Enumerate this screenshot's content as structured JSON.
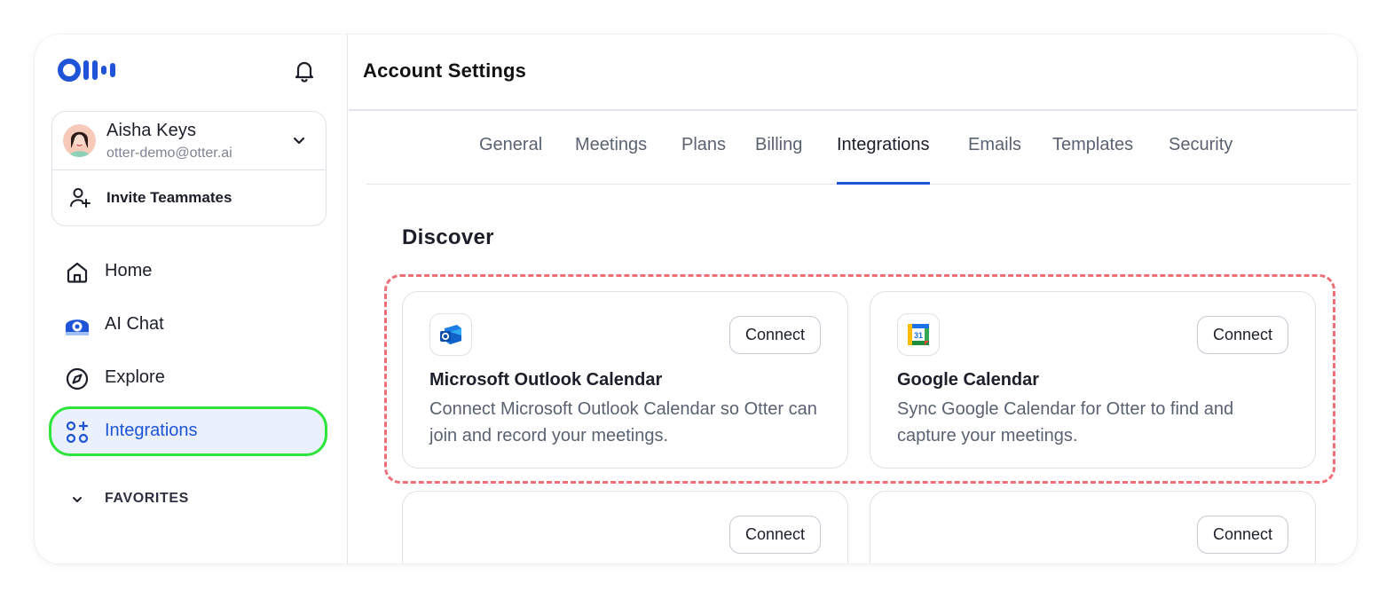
{
  "sidebar": {
    "user": {
      "name": "Aisha Keys",
      "email": "otter-demo@otter.ai"
    },
    "invite_label": "Invite Teammates",
    "nav": [
      {
        "label": "Home",
        "icon": "home-icon"
      },
      {
        "label": "AI Chat",
        "icon": "ai-chat-icon"
      },
      {
        "label": "Explore",
        "icon": "compass-icon"
      },
      {
        "label": "Integrations",
        "icon": "integrations-icon",
        "active": true
      }
    ],
    "favorites_label": "FAVORITES"
  },
  "main": {
    "title": "Account Settings",
    "tabs": [
      {
        "label": "General"
      },
      {
        "label": "Meetings"
      },
      {
        "label": "Plans"
      },
      {
        "label": "Billing"
      },
      {
        "label": "Integrations",
        "active": true
      },
      {
        "label": "Emails"
      },
      {
        "label": "Templates"
      },
      {
        "label": "Security"
      }
    ],
    "section_title": "Discover",
    "cards": [
      {
        "title": "Microsoft Outlook Calendar",
        "description": "Connect Microsoft Outlook Calendar so Otter can join and record your meetings.",
        "button": "Connect",
        "icon": "outlook-icon"
      },
      {
        "title": "Google Calendar",
        "description": "Sync Google Calendar for Otter to find and capture your meetings.",
        "button": "Connect",
        "icon": "google-calendar-icon",
        "icon_text": "31"
      },
      {
        "title": "",
        "description": "",
        "button": "Connect"
      },
      {
        "title": "",
        "description": "",
        "button": "Connect"
      }
    ]
  },
  "colors": {
    "accent": "#1f54d8",
    "active_highlight": "#2ee63b",
    "annotation_dash": "#ef6f78",
    "nav_active_bg": "#eaf1fd"
  }
}
